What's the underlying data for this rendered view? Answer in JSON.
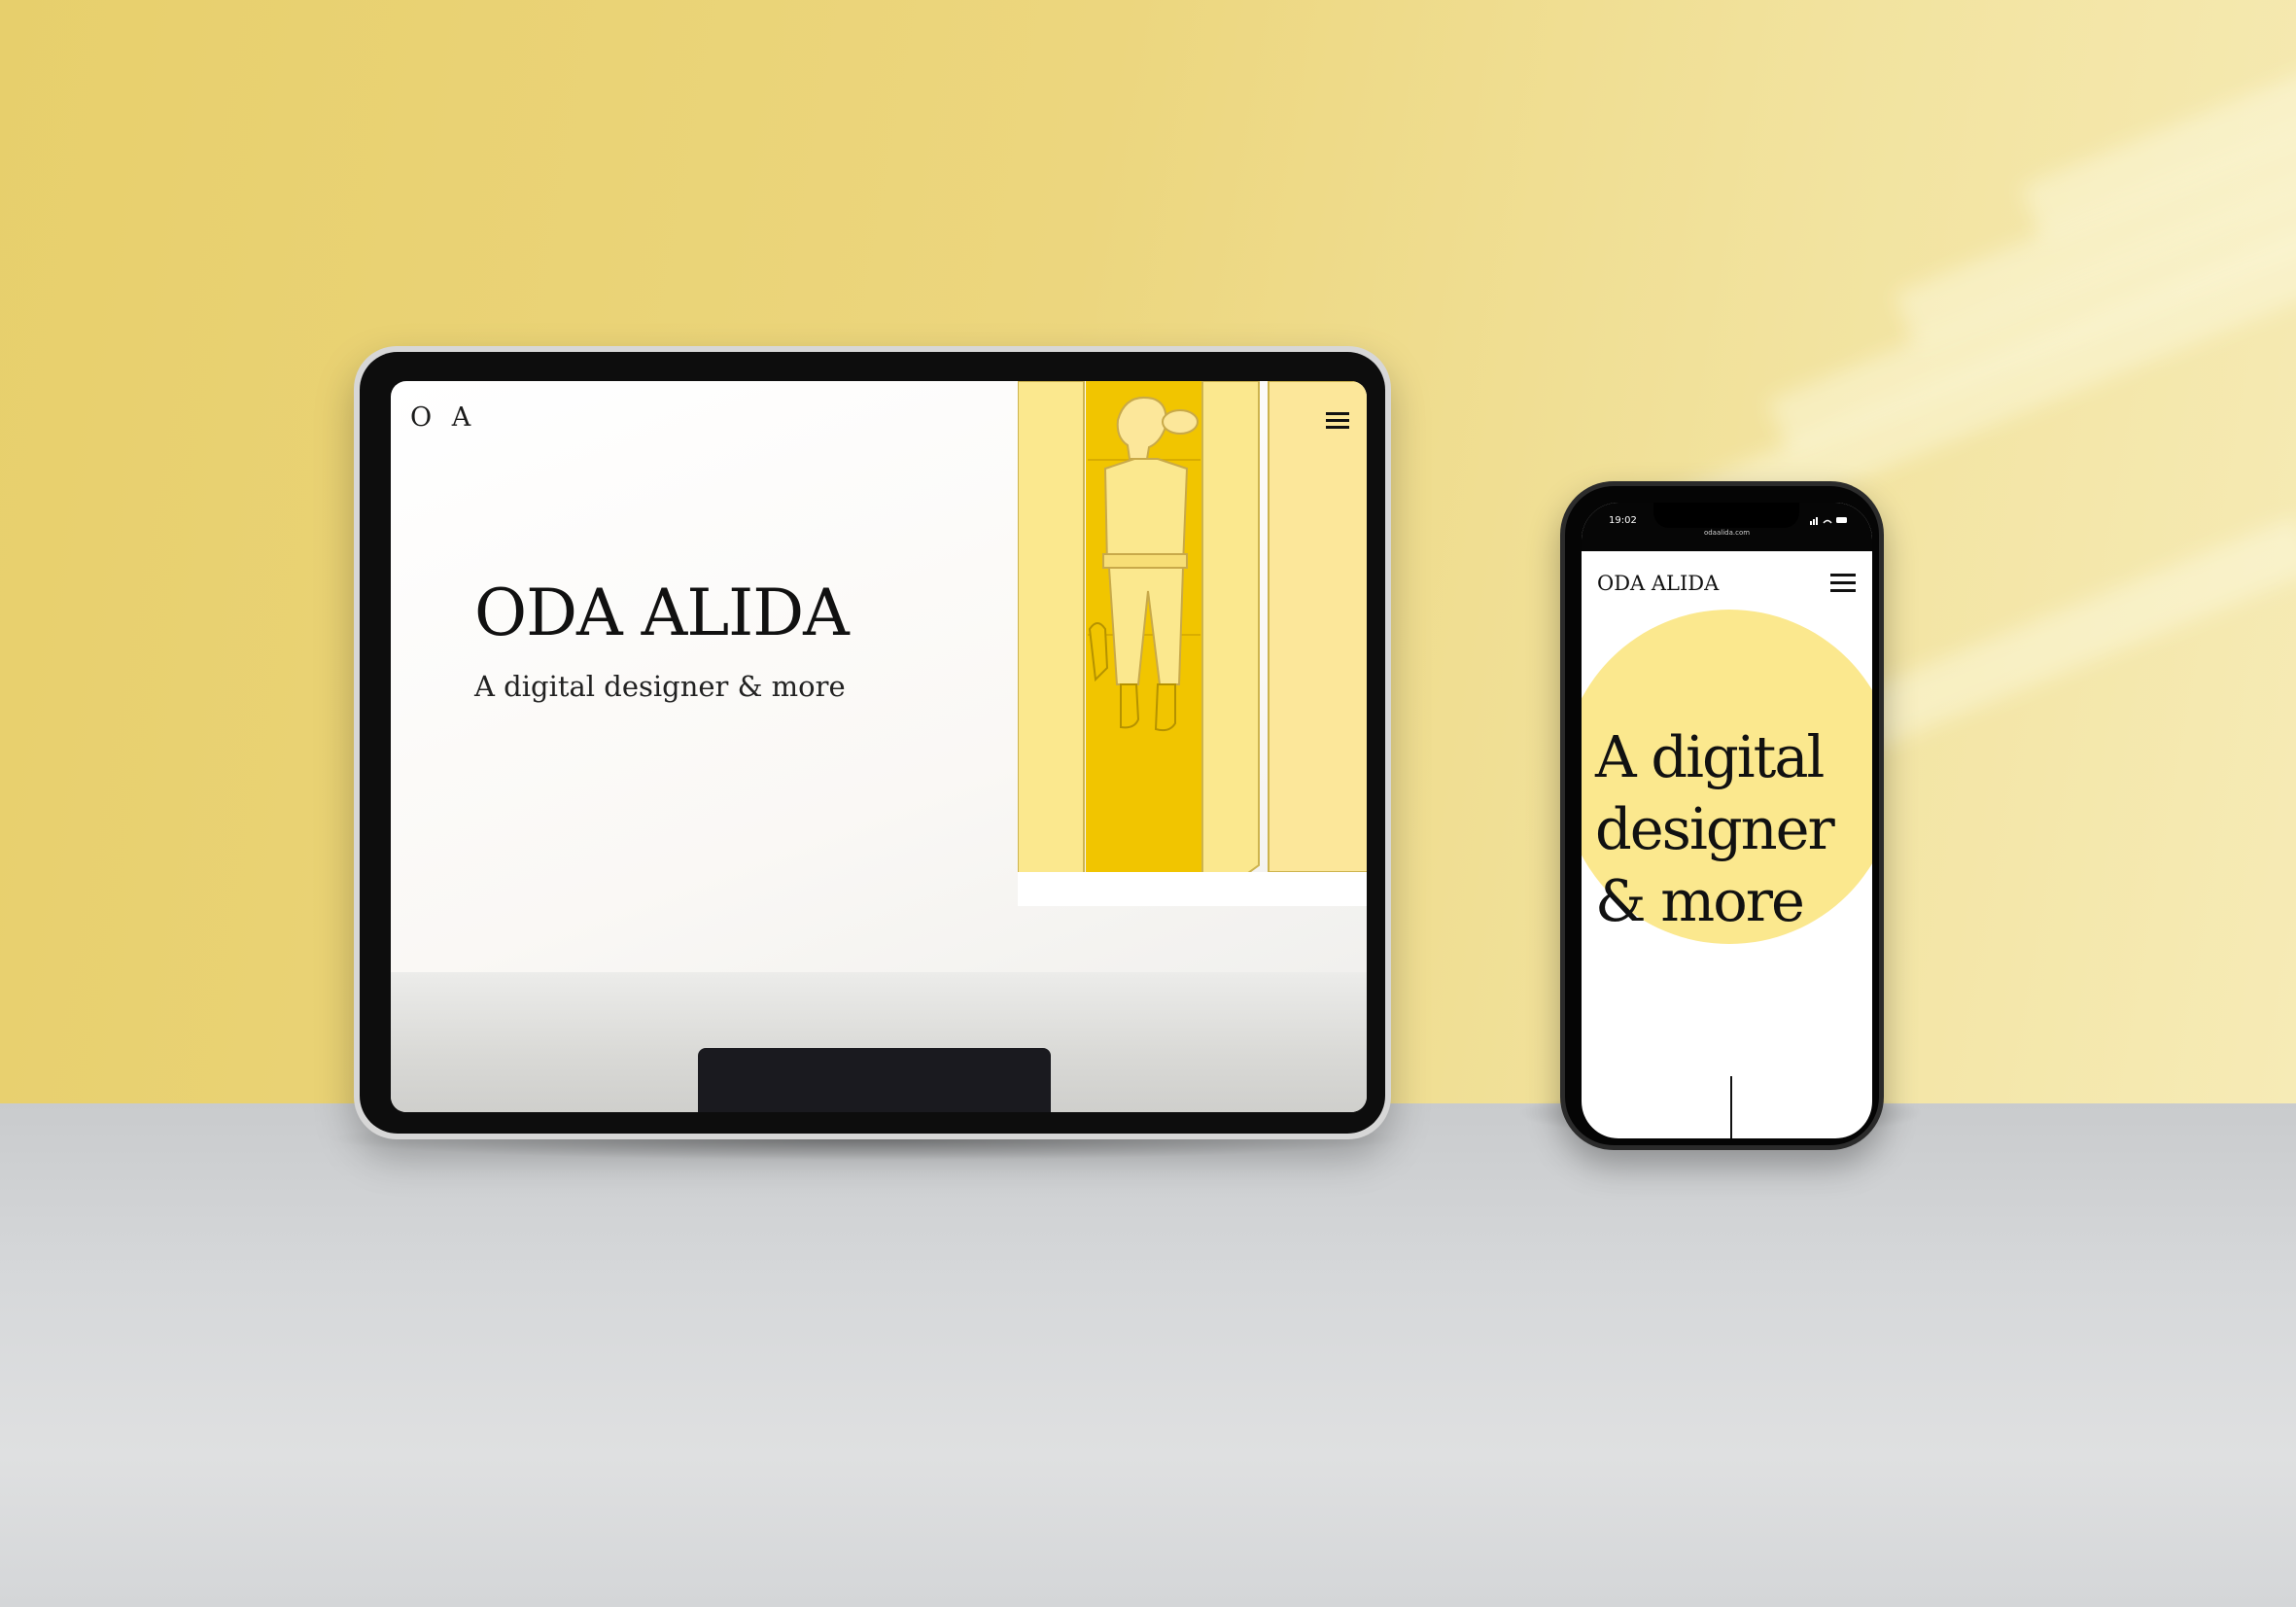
{
  "tablet_site": {
    "logo": "O A",
    "title": "ODA ALIDA",
    "subtitle": "A digital designer & more",
    "menu_icon": "hamburger-icon",
    "accent_color": "#fbe88e"
  },
  "phone_site": {
    "status_time": "19:02",
    "url": "odaalida.com",
    "logo": "ODA ALIDA",
    "menu_icon": "hamburger-icon",
    "headline_lines": [
      "A digital",
      "designer",
      "& more"
    ],
    "accent_color": "#fbe88e"
  }
}
